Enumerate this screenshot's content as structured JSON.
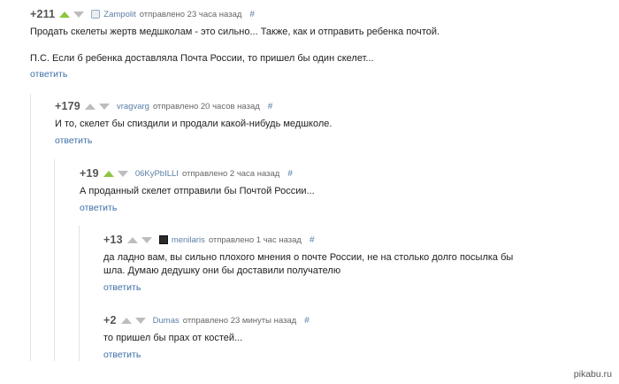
{
  "comments": [
    {
      "score": "+211",
      "vote": "up",
      "author": "Zampolit",
      "sent": "отправлено 23 часа назад",
      "hash": "#",
      "lines": [
        "Продать скелеты жертв медшколам - это сильно... Также, как и отправить ребенка почтой.",
        "",
        "П.С. Если б ребенка доставляла Почта России, то пришел бы один скелет..."
      ],
      "reply": "ответить"
    },
    {
      "score": "+179",
      "vote": "none",
      "author": "vragvarg",
      "sent": "отправлено 20 часов назад",
      "hash": "#",
      "lines": [
        "И то, скелет бы спиздили и продали какой-нибудь медшколе."
      ],
      "reply": "ответить"
    },
    {
      "score": "+19",
      "vote": "up",
      "author": "06KyPbILLI",
      "sent": "отправлено 2 часа назад",
      "hash": "#",
      "lines": [
        "А проданный скелет отправили бы Почтой России..."
      ],
      "reply": "ответить"
    },
    {
      "score": "+13",
      "vote": "none",
      "author": "menilaris",
      "sent": "отправлено 1 час назад",
      "hash": "#",
      "lines": [
        "да ладно вам, вы сильно плохого мнения о почте России, не на столько долго посылка бы",
        "шла. Думаю дедушку они бы доставили получателю"
      ],
      "reply": "ответить"
    },
    {
      "score": "+2",
      "vote": "none",
      "author": "Dumas",
      "sent": "отправлено 23 минуты назад",
      "hash": "#",
      "lines": [
        "то пришел бы прах от костей..."
      ],
      "reply": "ответить"
    }
  ],
  "watermark": "pikabu.ru"
}
